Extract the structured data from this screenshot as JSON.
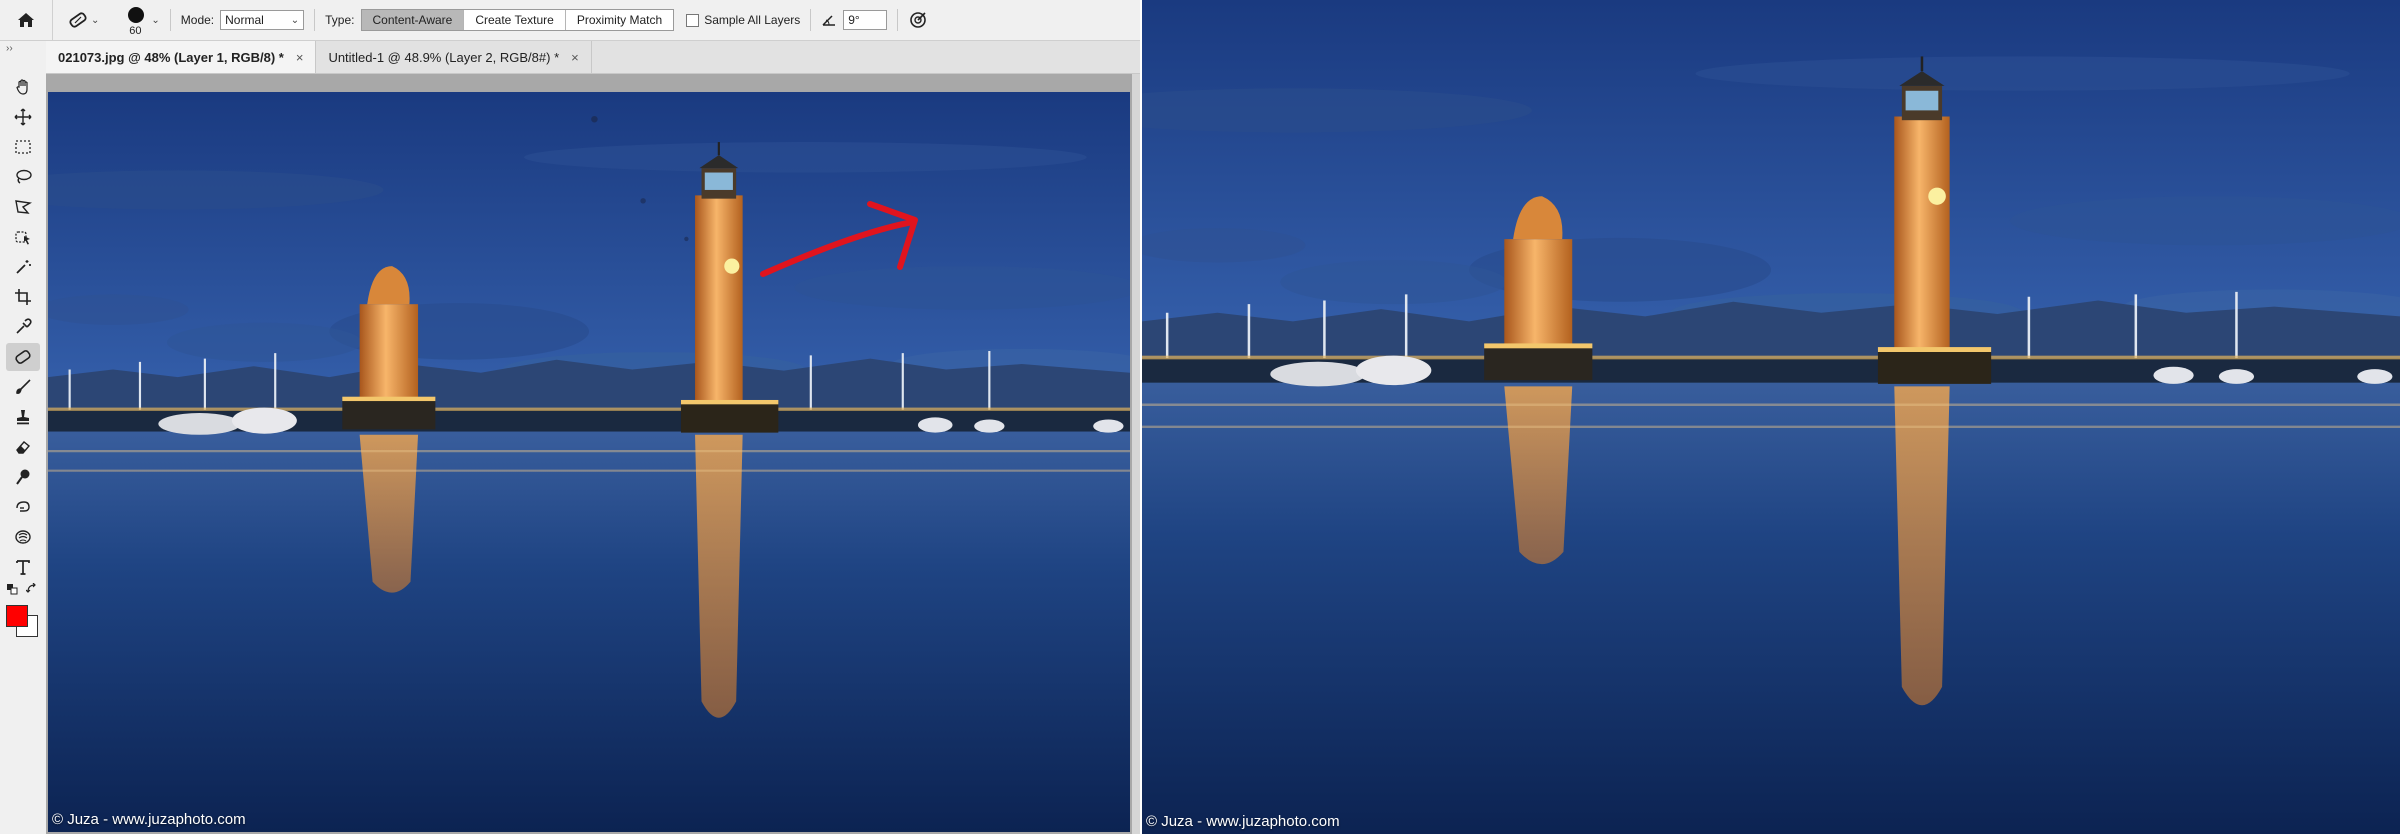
{
  "options_bar": {
    "brush_size": "60",
    "mode_label": "Mode:",
    "mode_value": "Normal",
    "type_label": "Type:",
    "type_options": [
      "Content-Aware",
      "Create Texture",
      "Proximity Match"
    ],
    "type_selected": "Content-Aware",
    "sample_all_layers_label": "Sample All Layers",
    "sample_all_layers_checked": false,
    "angle_value": "9°"
  },
  "tabs": [
    {
      "label": "021073.jpg @ 48% (Layer 1, RGB/8) *",
      "close": "×",
      "active": true
    },
    {
      "label": "Untitled-1 @ 48.9% (Layer 2, RGB/8#) *",
      "close": "×",
      "active": false
    }
  ],
  "toolbar": {
    "grip": "››",
    "tools": [
      "hand-tool-icon",
      "move-tool-icon",
      "marquee-tool-icon",
      "lasso-tool-icon",
      "polygonal-lasso-icon",
      "object-selection-icon",
      "magic-wand-icon",
      "crop-tool-icon",
      "eyedropper-icon",
      "patch-tool-icon",
      "brush-tool-icon",
      "clone-stamp-icon",
      "eraser-icon",
      "dodge-tool-icon",
      "smudge-tool-icon",
      "sponge-tool-icon",
      "type-tool-icon"
    ],
    "selected_tool": "patch-tool-icon",
    "foreground_color": "#ff0000",
    "background_color": "#ffffff"
  },
  "document": {
    "caption": "© Juza - www.juzaphoto.com"
  },
  "result_image": {
    "caption": "© Juza - www.juzaphoto.com"
  },
  "colors": {
    "annotation_arrow": "#e0141e",
    "sky_top": "#1d3f88",
    "sky_horizon": "#5b86c8",
    "water": "#143366",
    "lighthouse_glow": "#f2a04a"
  }
}
